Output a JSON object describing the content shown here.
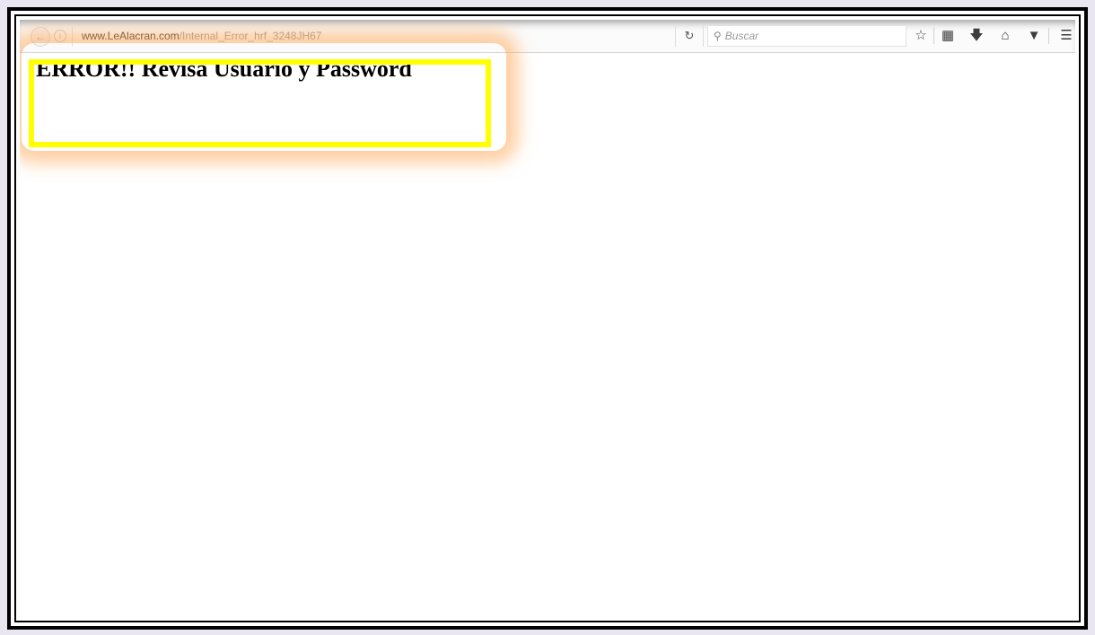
{
  "browser": {
    "url_host": "www.LeAlacran.com",
    "url_path": "/Internal_Error_hrf_3248JH67",
    "search_placeholder": "Buscar",
    "icons": [
      "back-icon",
      "info-icon",
      "reload-icon",
      "search-icon",
      "bookmark-star-icon",
      "reading-list-icon",
      "download-icon",
      "home-icon",
      "pocket-icon",
      "menu-icon"
    ]
  },
  "page": {
    "heading": "ERROR!! Revisa Usuario y Password"
  },
  "annotation": {
    "highlight_color": "#ffff00",
    "glow_color": "#ffaa5a"
  }
}
